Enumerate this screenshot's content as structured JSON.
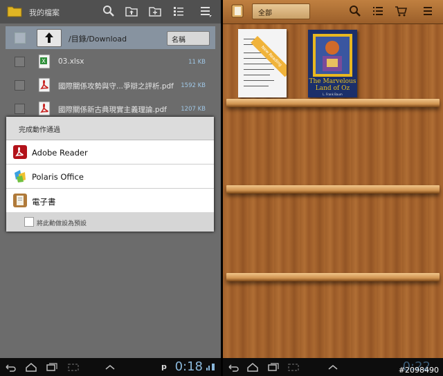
{
  "left": {
    "title": "我的檔案",
    "path": "/目錄/Download",
    "sort": "名稱",
    "files": [
      {
        "name": "03.xlsx",
        "size": "11 KB",
        "type": "excel"
      },
      {
        "name": "國際關係攻勢與守...爭辯之評析.pdf",
        "size": "1592 KB",
        "type": "pdf"
      },
      {
        "name": "國際關係新古典現實主義理論.pdf",
        "size": "1207 KB",
        "type": "pdf"
      }
    ],
    "dialog": {
      "title": "完成動作通過",
      "options": [
        "Adobe Reader",
        "Polaris Office",
        "電子書"
      ],
      "default_label": "將此動做設為預設"
    },
    "clock": "0:18",
    "status_letter": "p"
  },
  "right": {
    "category": "全部",
    "book1_ribbon": "New Reading",
    "book2_title_lines": [
      "The Marvelous",
      "Land of Oz"
    ],
    "book2_author": "L. Frank Baum",
    "clock": "0:22"
  },
  "watermark": "#2098490",
  "colors": {
    "wood": "#a0602b",
    "highlight": "#8793a0",
    "clock": "#8ab7da"
  }
}
